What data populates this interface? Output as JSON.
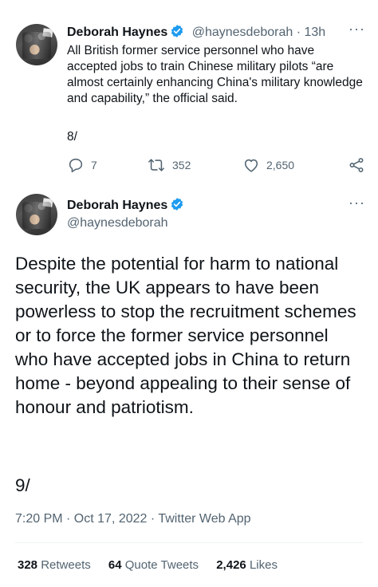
{
  "tweet1": {
    "author_name": "Deborah Haynes",
    "handle": "@haynesdeborah",
    "time": "13h",
    "text": "All British former service personnel who have accepted jobs to train Chinese military pilots “are almost certainly enhancing China's military knowledge and capability,” the official said.",
    "page_marker": "8/",
    "replies": "7",
    "retweets": "352",
    "likes": "2,650"
  },
  "tweet2": {
    "author_name": "Deborah Haynes",
    "handle": "@haynesdeborah",
    "text": "Despite the potential for harm to national security, the UK appears to have been powerless to stop the recruitment schemes or to force the former service personnel who have accepted jobs in China to return home - beyond appealing to their sense of honour and patriotism.",
    "page_marker": "9/",
    "timestamp": "7:20 PM · Oct 17, 2022 · Twitter Web App",
    "stats": {
      "retweets_count": "328",
      "retweets_label": "Retweets",
      "quotes_count": "64",
      "quotes_label": "Quote Tweets",
      "likes_count": "2,426",
      "likes_label": "Likes"
    }
  },
  "more_label": "···",
  "colors": {
    "accent": "#1d9bf0",
    "muted": "#536471",
    "text": "#0f1419"
  }
}
